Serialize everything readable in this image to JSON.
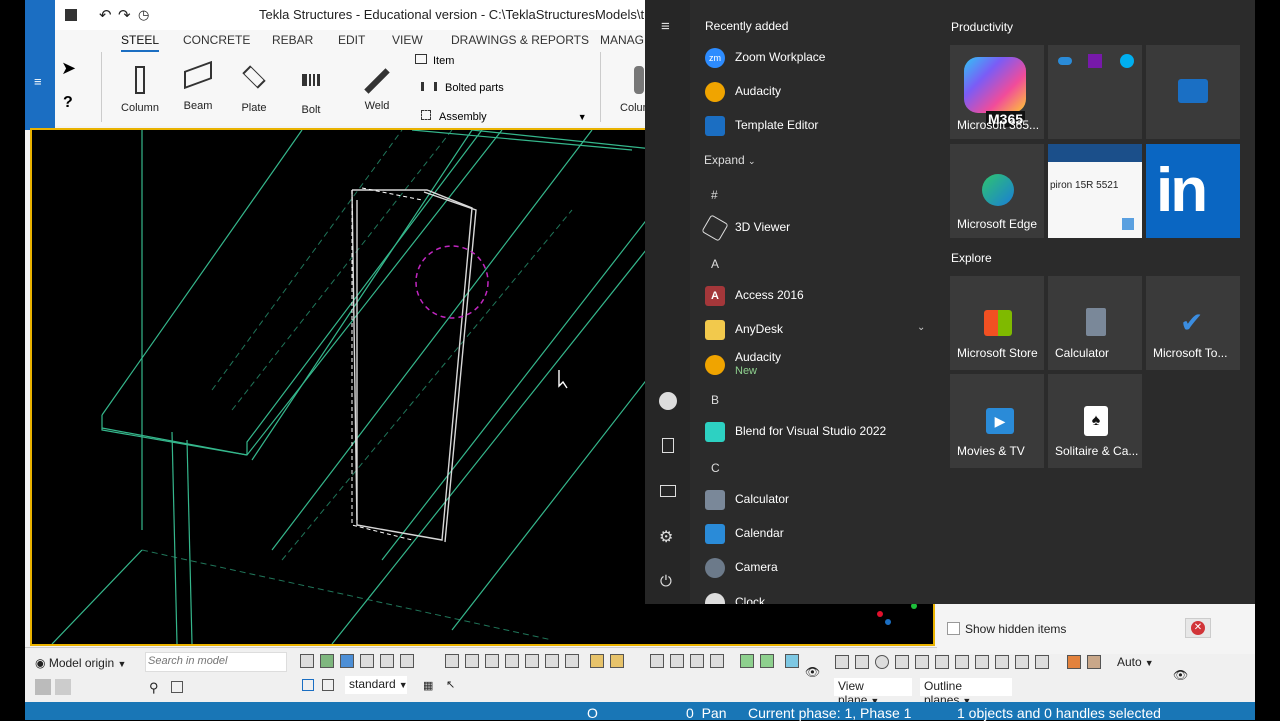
{
  "tekla": {
    "title": "Tekla Structures - Educational version - C:\\TeklaStructuresModels\\tutorial mo",
    "tabs": [
      "STEEL",
      "CONCRETE",
      "REBAR",
      "EDIT",
      "VIEW",
      "DRAWINGS & REPORTS",
      "MANAGE"
    ],
    "ribbon": {
      "column": "Column",
      "beam": "Beam",
      "plate": "Plate",
      "bolt": "Bolt",
      "weld": "Weld",
      "item": "Item",
      "bolted_parts": "Bolted parts",
      "assembly": "Assembly",
      "concrete_column": "Column"
    },
    "bottom": {
      "model_origin": "Model origin",
      "search_placeholder": "Search in model",
      "standard": "standard",
      "view_plane": "View plane",
      "outline_planes": "Outline planes",
      "auto": "Auto"
    },
    "status": {
      "o": "O",
      "pan": "0  Pan",
      "phase": "Current phase: 1, Phase 1",
      "selected": "1 objects and 0 handles selected"
    }
  },
  "start_menu": {
    "recently_added": "Recently added",
    "recent_apps": [
      {
        "label": "Zoom Workplace",
        "color": "#2d8cff"
      },
      {
        "label": "Audacity",
        "color": "#f0a400"
      },
      {
        "label": "Template Editor",
        "color": "#1b6ec2"
      }
    ],
    "expand": "Expand",
    "letters": {
      "hash": "#",
      "a": "A",
      "b": "B",
      "c": "C"
    },
    "apps": {
      "viewer": "3D Viewer",
      "access": "Access 2016",
      "anydesk": "AnyDesk",
      "audacity": "Audacity",
      "audacity_badge": "New",
      "blend": "Blend for Visual Studio 2022",
      "calculator": "Calculator",
      "calendar": "Calendar",
      "camera": "Camera",
      "clock": "Clock"
    },
    "productivity": "Productivity",
    "explore": "Explore",
    "tiles": {
      "m365": "Microsoft 365...",
      "m365_badge": "M365",
      "edge": "Microsoft Edge",
      "store": "Microsoft Store",
      "calculator": "Calculator",
      "todo": "Microsoft To...",
      "movies": "Movies & TV",
      "solitaire": "Solitaire & Ca..."
    },
    "thumb_text": "piron 15R 5521"
  },
  "tray": {
    "show_hidden": "Show hidden items"
  }
}
